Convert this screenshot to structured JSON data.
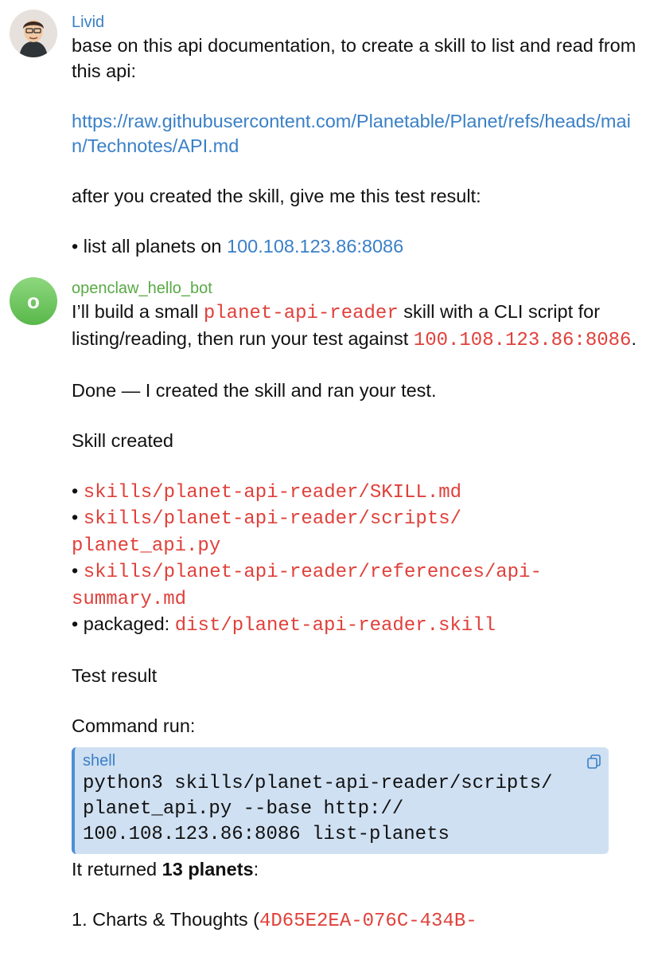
{
  "user_message": {
    "sender": "Livid",
    "line1": "base on this api documentation, to create a skill to list and read from this api:",
    "link": "https://raw.githubusercontent.com/Planetable/Planet/refs/heads/main/Technotes/API.md",
    "line2": "after you created the skill, give me this test result:",
    "bullet_text": "• list all planets on ",
    "bullet_link": "100.108.123.86:8086"
  },
  "bot_message": {
    "sender": "openclaw_hello_bot",
    "avatar_letter": "o",
    "intro_pre": "I’ll build a small ",
    "intro_code": "planet-api-reader",
    "intro_mid": " skill with a CLI script for listing/reading, then run your test against ",
    "intro_addr": "100.108.123.86:8086",
    "intro_end": ".",
    "done": "Done — I created the skill and ran your test.",
    "skill_created": "Skill created",
    "files": [
      "skills/planet-api-reader/SKILL.md",
      "skills/planet-api-reader/scripts/planet_api.py",
      "skills/planet-api-reader/references/api-summary.md"
    ],
    "packaged_label": "packaged: ",
    "packaged_file": "dist/planet-api-reader.skill",
    "test_result": "Test result",
    "command_run": "Command run:",
    "codeblock": {
      "lang": "shell",
      "code": "python3 skills/planet-api-reader/scripts/\nplanet_api.py --base http://\n100.108.123.86:8086 list-planets"
    },
    "returned_pre": "It returned ",
    "returned_bold": "13 planets",
    "returned_end": ":",
    "item1_pre": "1. Charts & Thoughts (",
    "item1_code": "4D65E2EA-076C-434B-"
  },
  "icons": {
    "copy": "copy-icon",
    "avatar_user": "avatar"
  },
  "colors": {
    "link": "#3a80c7",
    "code": "#e0403a",
    "bot_name": "#58a945",
    "codeblock_bg": "#cfe0f2"
  }
}
